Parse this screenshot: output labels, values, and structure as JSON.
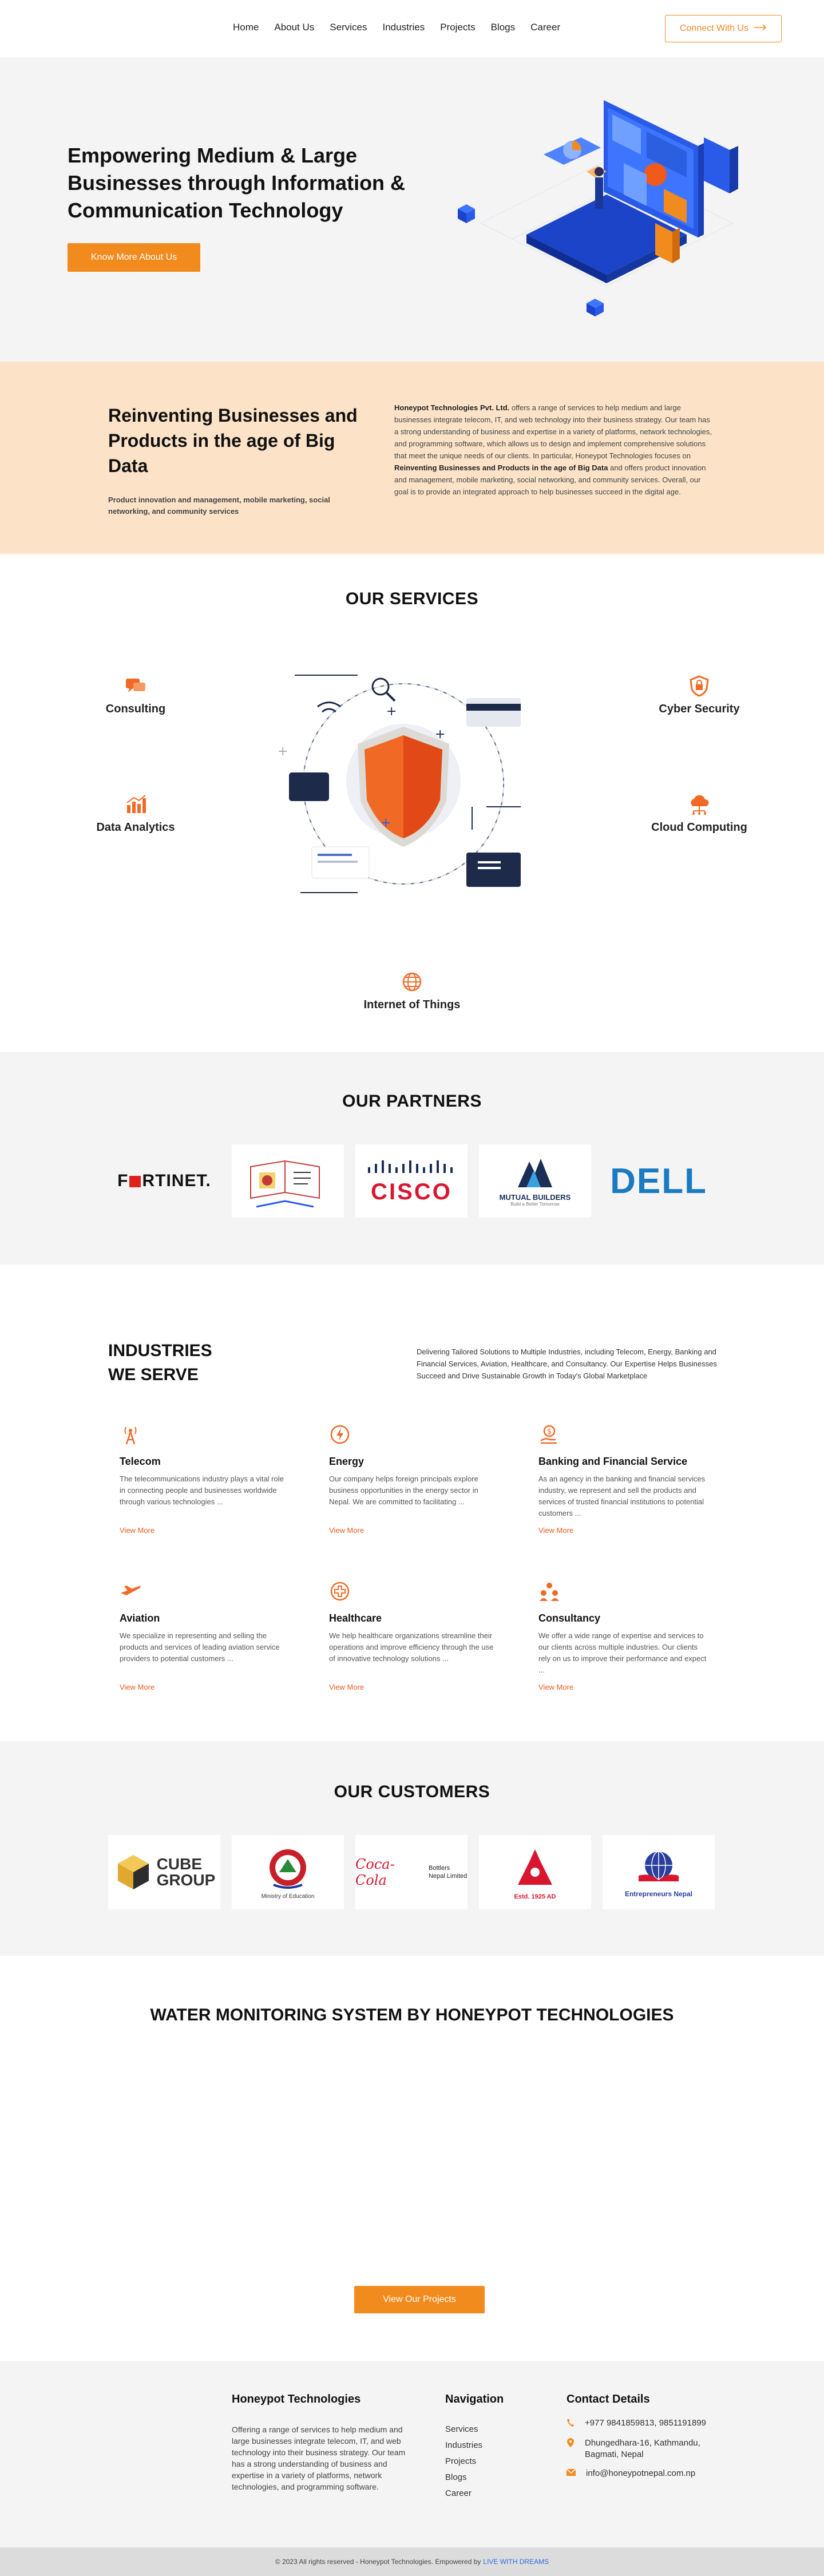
{
  "nav": {
    "items": [
      "Home",
      "About Us",
      "Services",
      "Industries",
      "Projects",
      "Blogs",
      "Career"
    ],
    "connect_label": "Connect With Us"
  },
  "hero": {
    "title": "Empowering Medium & Large Businesses through Information & Communication Technology",
    "button": "Know More About Us"
  },
  "reinvent": {
    "title": "Reinventing Businesses and Products in the age of Big Data",
    "subtitle": "Product innovation and management, mobile marketing, social networking, and community services",
    "company": "Honeypot Technologies Pvt. Ltd.",
    "body_1": "offers a range of services to help medium and large businesses integrate telecom, IT, and web technology into their business strategy. Our team has a strong understanding of business and expertise in a variety of platforms, network technologies, and programming software, which allows us to design and implement comprehensive solutions that meet the unique needs of our clients. In particular, Honeypot Technologies focuses on",
    "highlight": "Reinventing Businesses and Products in the age of Big Data",
    "body_2": "and offers product innovation and management, mobile marketing, social networking, and community services. Overall, our goal is to provide an integrated approach to help businesses succeed in the digital age."
  },
  "services": {
    "title": "OUR SERVICES",
    "items": {
      "consulting": "Consulting",
      "cyber": "Cyber Security",
      "analytics": "Data Analytics",
      "cloud": "Cloud Computing",
      "iot": "Internet of Things"
    }
  },
  "partners": {
    "title": "OUR PARTNERS",
    "logos": {
      "fortinet": "F",
      "fortinet_rest": "RTINET.",
      "cisco": "CISCO",
      "mutual": "MUTUAL BUILDERS",
      "mutual_tag": "Build a Better Tomorrow",
      "dell": "DELL"
    }
  },
  "industries": {
    "title_1": "INDUSTRIES",
    "title_2": "WE SERVE",
    "description": "Delivering Tailored Solutions to Multiple Industries, including Telecom, Energy, Banking and Financial Services, Aviation, Healthcare, and Consultancy. Our Expertise Helps Businesses Succeed and Drive Sustainable Growth in Today's Global Marketplace",
    "more_label": "View More",
    "items": [
      {
        "name": "Telecom",
        "text": "The telecommunications industry plays a vital role in connecting people and businesses worldwide through various technologies ..."
      },
      {
        "name": "Energy",
        "text": "Our company helps foreign principals explore business opportunities in the energy sector in Nepal. We are committed to facilitating ..."
      },
      {
        "name": "Banking and Financial Service",
        "text": "As an agency in the banking and financial services industry, we represent and sell the products and services of trusted financial institutions to potential customers ..."
      },
      {
        "name": "Aviation",
        "text": "We specialize in representing and selling the products and services of leading aviation service providers to potential customers ..."
      },
      {
        "name": "Healthcare",
        "text": "We help healthcare organizations streamline their operations and improve efficiency through the use of innovative technology solutions ..."
      },
      {
        "name": "Consultancy",
        "text": "We offer a wide range of expertise and services to our clients across multiple industries. Our clients rely on us to improve their performance and expect ..."
      }
    ]
  },
  "customers": {
    "title": "OUR CUSTOMERS",
    "logos": {
      "cube_1": "CUBE",
      "cube_2": "GROUP",
      "ministry": "Ministry of Education",
      "coke": "Coca-Cola",
      "bottlers": "Bottlers Nepal Limited",
      "est": "Estd. 1925 AD",
      "entre": "Entrepreneurs Nepal"
    }
  },
  "water": {
    "title": "WATER MONITORING SYSTEM BY HONEYPOT TECHNOLOGIES",
    "button": "View Our Projects"
  },
  "footer": {
    "company_title": "Honeypot Technologies",
    "about": "Offering a range of services to help medium and large businesses integrate telecom, IT, and web technology into their business strategy. Our team has a strong understanding of business and expertise in a variety of platforms, network technologies, and programming software.",
    "nav_title": "Navigation",
    "nav_items": [
      "Services",
      "Industries",
      "Projects",
      "Blogs",
      "Career"
    ],
    "contact_title": "Contact Details",
    "phone": "+977 9841859813, 9851191899",
    "address": "Dhungedhara-16, Kathmandu, Bagmati, Nepal",
    "email": "info@honeypotnepal.com.np",
    "copyright": "© 2023 All rights reserved - Honeypot Technologies.  Empowered by",
    "empowered": "LIVE WITH DREAMS"
  },
  "colors": {
    "accent": "#f28b1d",
    "link": "#e85a1e",
    "hero_bg": "#f4f4f4",
    "reinvent_bg": "#fce3c7"
  }
}
